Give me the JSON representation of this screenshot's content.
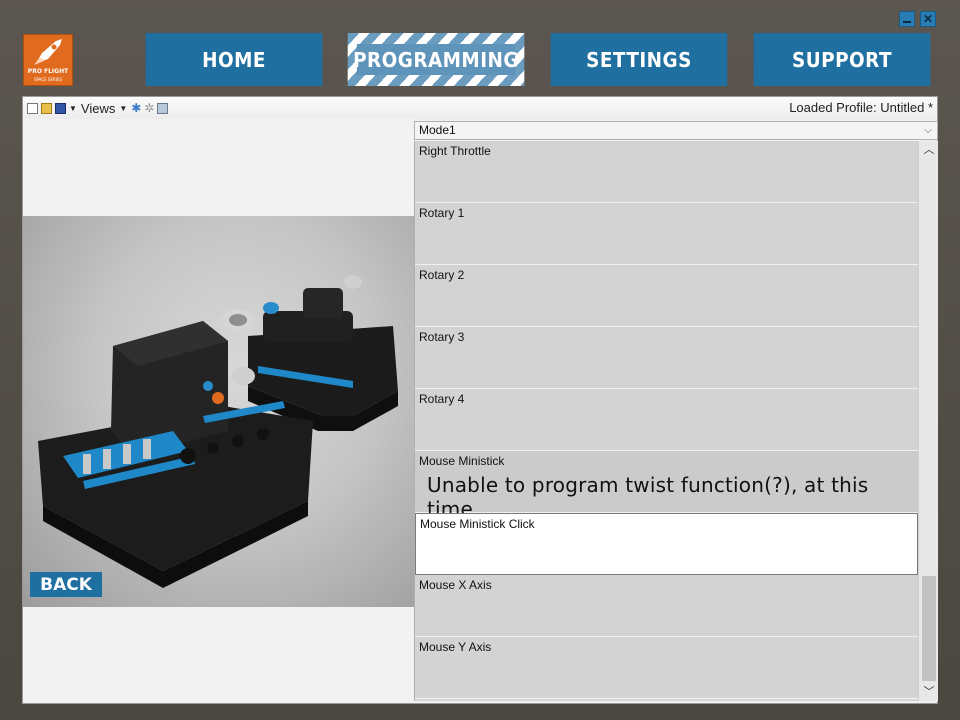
{
  "window": {
    "minimize_icon": "minimize-icon",
    "close_label": "✕"
  },
  "logo": {
    "line1": "PRO FLIGHT",
    "line2": "SPACE SERIES"
  },
  "nav": {
    "home": "HOME",
    "programming": "PROGRAMMING",
    "settings": "SETTINGS",
    "support": "SUPPORT"
  },
  "toolbar": {
    "views_label": "Views",
    "loaded_profile": "Loaded Profile: Untitled *"
  },
  "mode_select": {
    "value": "Mode1"
  },
  "list": {
    "items": [
      {
        "label": "Right Throttle"
      },
      {
        "label": "Rotary 1"
      },
      {
        "label": "Rotary 2"
      },
      {
        "label": "Rotary 3"
      },
      {
        "label": "Rotary 4"
      },
      {
        "label": "Mouse Ministick",
        "note": "Unable to program twist function(?), at this time."
      },
      {
        "label": "Mouse Ministick Click"
      },
      {
        "label": "Mouse X Axis"
      },
      {
        "label": "Mouse Y Axis"
      }
    ]
  },
  "back_label": "BACK",
  "colors": {
    "nav_blue": "#1f6fa0",
    "accent_orange": "#e06a1e"
  }
}
